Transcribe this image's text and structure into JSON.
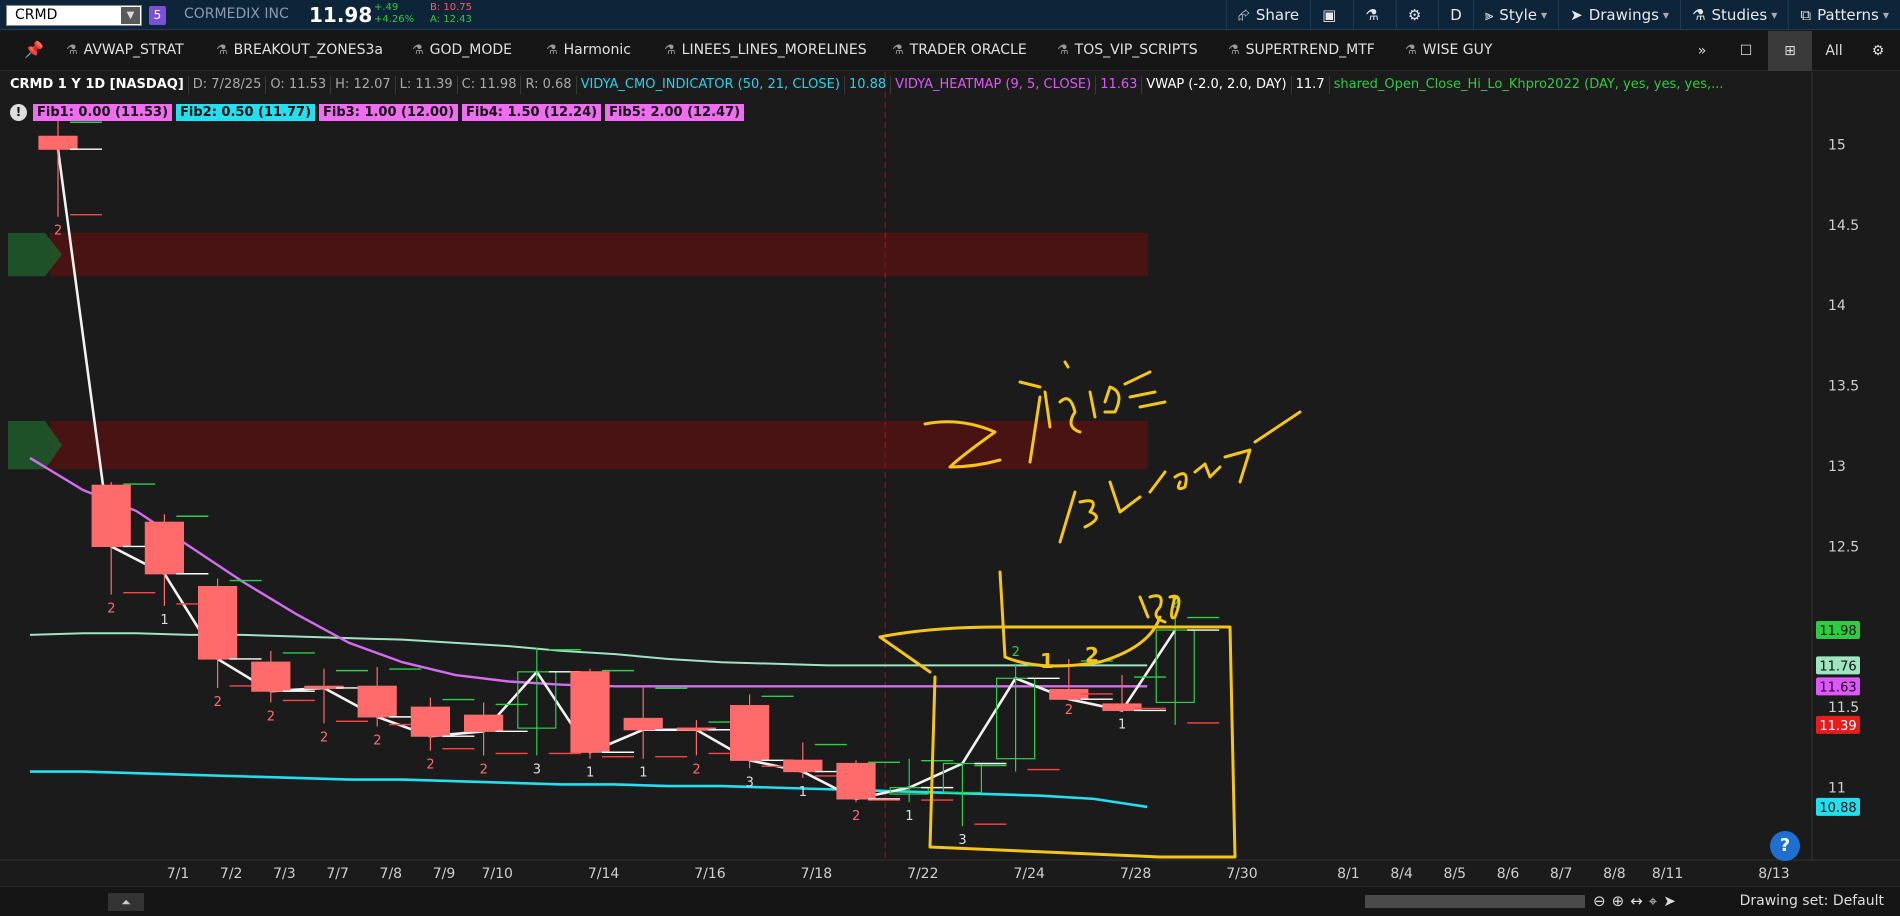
{
  "topbar": {
    "symbol": "CRMD",
    "link_number": "5",
    "company": "CORMEDIX INC",
    "last_price": "11.98",
    "change": "+.49",
    "change_pct": "+4.26%",
    "bid": "B: 10.75",
    "ask": "A: 12.43",
    "share": "Share",
    "period": "D",
    "style": "Style",
    "drawings": "Drawings",
    "studies": "Studies",
    "patterns": "Patterns"
  },
  "strategies": [
    "AVWAP_STRAT",
    "BREAKOUT_ZONES3a",
    "GOD_MODE",
    "Harmonic",
    "LINEES_LINES_MORELINES",
    "TRADER ORACLE",
    "TOS_VIP_SCRIPTS",
    "SUPERTREND_MTF",
    "WISE GUY"
  ],
  "stratbar": {
    "more": "»",
    "all": "All"
  },
  "infobar": {
    "title": "CRMD 1 Y 1D [NASDAQ]",
    "date": "D: 7/28/25",
    "open": "O: 11.53",
    "high": "H: 12.07",
    "low": "L: 11.39",
    "close": "C: 11.98",
    "range": "R: 0.68",
    "vidya_cmo": "VIDYA_CMO_INDICATOR (50, 21, CLOSE)",
    "vidya_cmo_val": "10.88",
    "vidya_heat": "VIDYA_HEATMAP (9, 5, CLOSE)",
    "vidya_heat_val": "11.63",
    "vwap": "VWAP (-2.0, 2.0, DAY)",
    "vwap_val": "11.7",
    "shared": "shared_Open_Close_Hi_Lo_Khpro2022 (DAY, yes, yes, yes,..."
  },
  "fibs": [
    {
      "label": "Fib1: 0.00 (11.53)",
      "color": "#f06cf0"
    },
    {
      "label": "Fib2: 0.50 (11.77)",
      "color": "#22e0f0"
    },
    {
      "label": "Fib3: 1.00 (12.00)",
      "color": "#f06cf0"
    },
    {
      "label": "Fib4: 1.50 (12.24)",
      "color": "#f06cf0"
    },
    {
      "label": "Fib5: 2.00 (12.47)",
      "color": "#f06cf0"
    }
  ],
  "price_axis": [
    "15",
    "14.5",
    "14",
    "13.5",
    "13",
    "12.5",
    "11.5",
    "11"
  ],
  "price_tags": [
    {
      "value": "11.98",
      "price": 11.98,
      "color": "#2ecc40",
      "text_color": "#111"
    },
    {
      "value": "11.76",
      "price": 11.76,
      "color": "#9ee6c0",
      "text_color": "#111"
    },
    {
      "value": "11.63",
      "price": 11.63,
      "color": "#e056fd",
      "text_color": "#111"
    },
    {
      "value": "11.39",
      "price": 11.39,
      "color": "#e81c1c",
      "text_color": "#fff"
    },
    {
      "value": "10.88",
      "price": 10.88,
      "color": "#22e0f0",
      "text_color": "#111"
    }
  ],
  "date_axis": [
    "7/1",
    "7/2",
    "7/3",
    "7/7",
    "7/8",
    "7/9",
    "7/10",
    "7/14",
    "7/16",
    "7/18",
    "7/22",
    "7/24",
    "7/28",
    "7/30",
    "8/1",
    "8/4",
    "8/5",
    "8/6",
    "8/7",
    "8/8",
    "8/11",
    "8/13"
  ],
  "annotations": {
    "handwritten": "2 INSIDE 1 BREAKOUT",
    "box_labels": "1 2 BO"
  },
  "statusbar": {
    "drawing_set": "Drawing set: Default",
    "help": "?"
  },
  "chart_data": {
    "type": "candlestick",
    "symbol": "CRMD",
    "timeframe": "1D",
    "ylim": [
      10.55,
      15.45
    ],
    "candles": [
      {
        "o": 15.05,
        "h": 15.15,
        "l": 14.55,
        "c": 14.97,
        "label": "2"
      },
      {
        "o": 12.88,
        "h": 12.9,
        "l": 12.2,
        "c": 12.5,
        "label": "2"
      },
      {
        "o": 12.65,
        "h": 12.7,
        "l": 12.13,
        "c": 12.33,
        "label": "1"
      },
      {
        "o": 12.25,
        "h": 12.3,
        "l": 11.62,
        "c": 11.8,
        "label": "2"
      },
      {
        "o": 11.78,
        "h": 11.85,
        "l": 11.53,
        "c": 11.6,
        "label": "2"
      },
      {
        "o": 11.63,
        "h": 11.74,
        "l": 11.4,
        "c": 11.62,
        "label": "2"
      },
      {
        "o": 11.63,
        "h": 11.75,
        "l": 11.38,
        "c": 11.44,
        "label": "2"
      },
      {
        "o": 11.5,
        "h": 11.56,
        "l": 11.23,
        "c": 11.32,
        "label": "2"
      },
      {
        "o": 11.45,
        "h": 11.53,
        "l": 11.2,
        "c": 11.35,
        "label": "2"
      },
      {
        "o": 11.37,
        "h": 11.87,
        "l": 11.2,
        "c": 11.72,
        "label": "3"
      },
      {
        "o": 11.72,
        "h": 11.74,
        "l": 11.18,
        "c": 11.22,
        "label": "1"
      },
      {
        "o": 11.43,
        "h": 11.63,
        "l": 11.18,
        "c": 11.36,
        "label": "1"
      },
      {
        "o": 11.37,
        "h": 11.42,
        "l": 11.2,
        "c": 11.36,
        "label": "2"
      },
      {
        "o": 11.51,
        "h": 11.58,
        "l": 11.12,
        "c": 11.17,
        "label": "3"
      },
      {
        "o": 11.17,
        "h": 11.28,
        "l": 11.06,
        "c": 11.1,
        "label": "1"
      },
      {
        "o": 11.15,
        "h": 11.17,
        "l": 10.91,
        "c": 10.93,
        "label": "2"
      },
      {
        "o": 10.96,
        "h": 11.18,
        "l": 10.91,
        "c": 11.0,
        "label": "1"
      },
      {
        "o": 10.97,
        "h": 11.15,
        "l": 10.76,
        "c": 11.15,
        "label": "3"
      },
      {
        "o": 11.18,
        "h": 11.77,
        "l": 11.1,
        "c": 11.68,
        "label": "2"
      },
      {
        "o": 11.61,
        "h": 11.8,
        "l": 11.57,
        "c": 11.55,
        "label": "2"
      },
      {
        "o": 11.52,
        "h": 11.7,
        "l": 11.48,
        "c": 11.48,
        "label": "1"
      },
      {
        "o": 11.53,
        "h": 12.07,
        "l": 11.39,
        "c": 11.98,
        "label": "2"
      }
    ],
    "vidya_cmo": [
      11.1,
      11.1,
      11.09,
      11.08,
      11.07,
      11.06,
      11.05,
      11.05,
      11.04,
      11.03,
      11.02,
      11.02,
      11.01,
      11.01,
      11.0,
      10.99,
      10.98,
      10.97,
      10.96,
      10.95,
      10.93,
      10.88
    ],
    "vidya_heatmap": [
      13.05,
      12.85,
      12.72,
      12.5,
      12.28,
      12.08,
      11.9,
      11.78,
      11.7,
      11.66,
      11.64,
      11.63,
      11.63,
      11.63,
      11.63,
      11.63,
      11.63,
      11.63,
      11.63,
      11.63,
      11.63,
      11.63
    ],
    "vwap_band": [
      11.95,
      11.96,
      11.96,
      11.95,
      11.95,
      11.94,
      11.93,
      11.92,
      11.9,
      11.88,
      11.85,
      11.83,
      11.8,
      11.78,
      11.77,
      11.76,
      11.76,
      11.76,
      11.76,
      11.76,
      11.76,
      11.76
    ]
  }
}
